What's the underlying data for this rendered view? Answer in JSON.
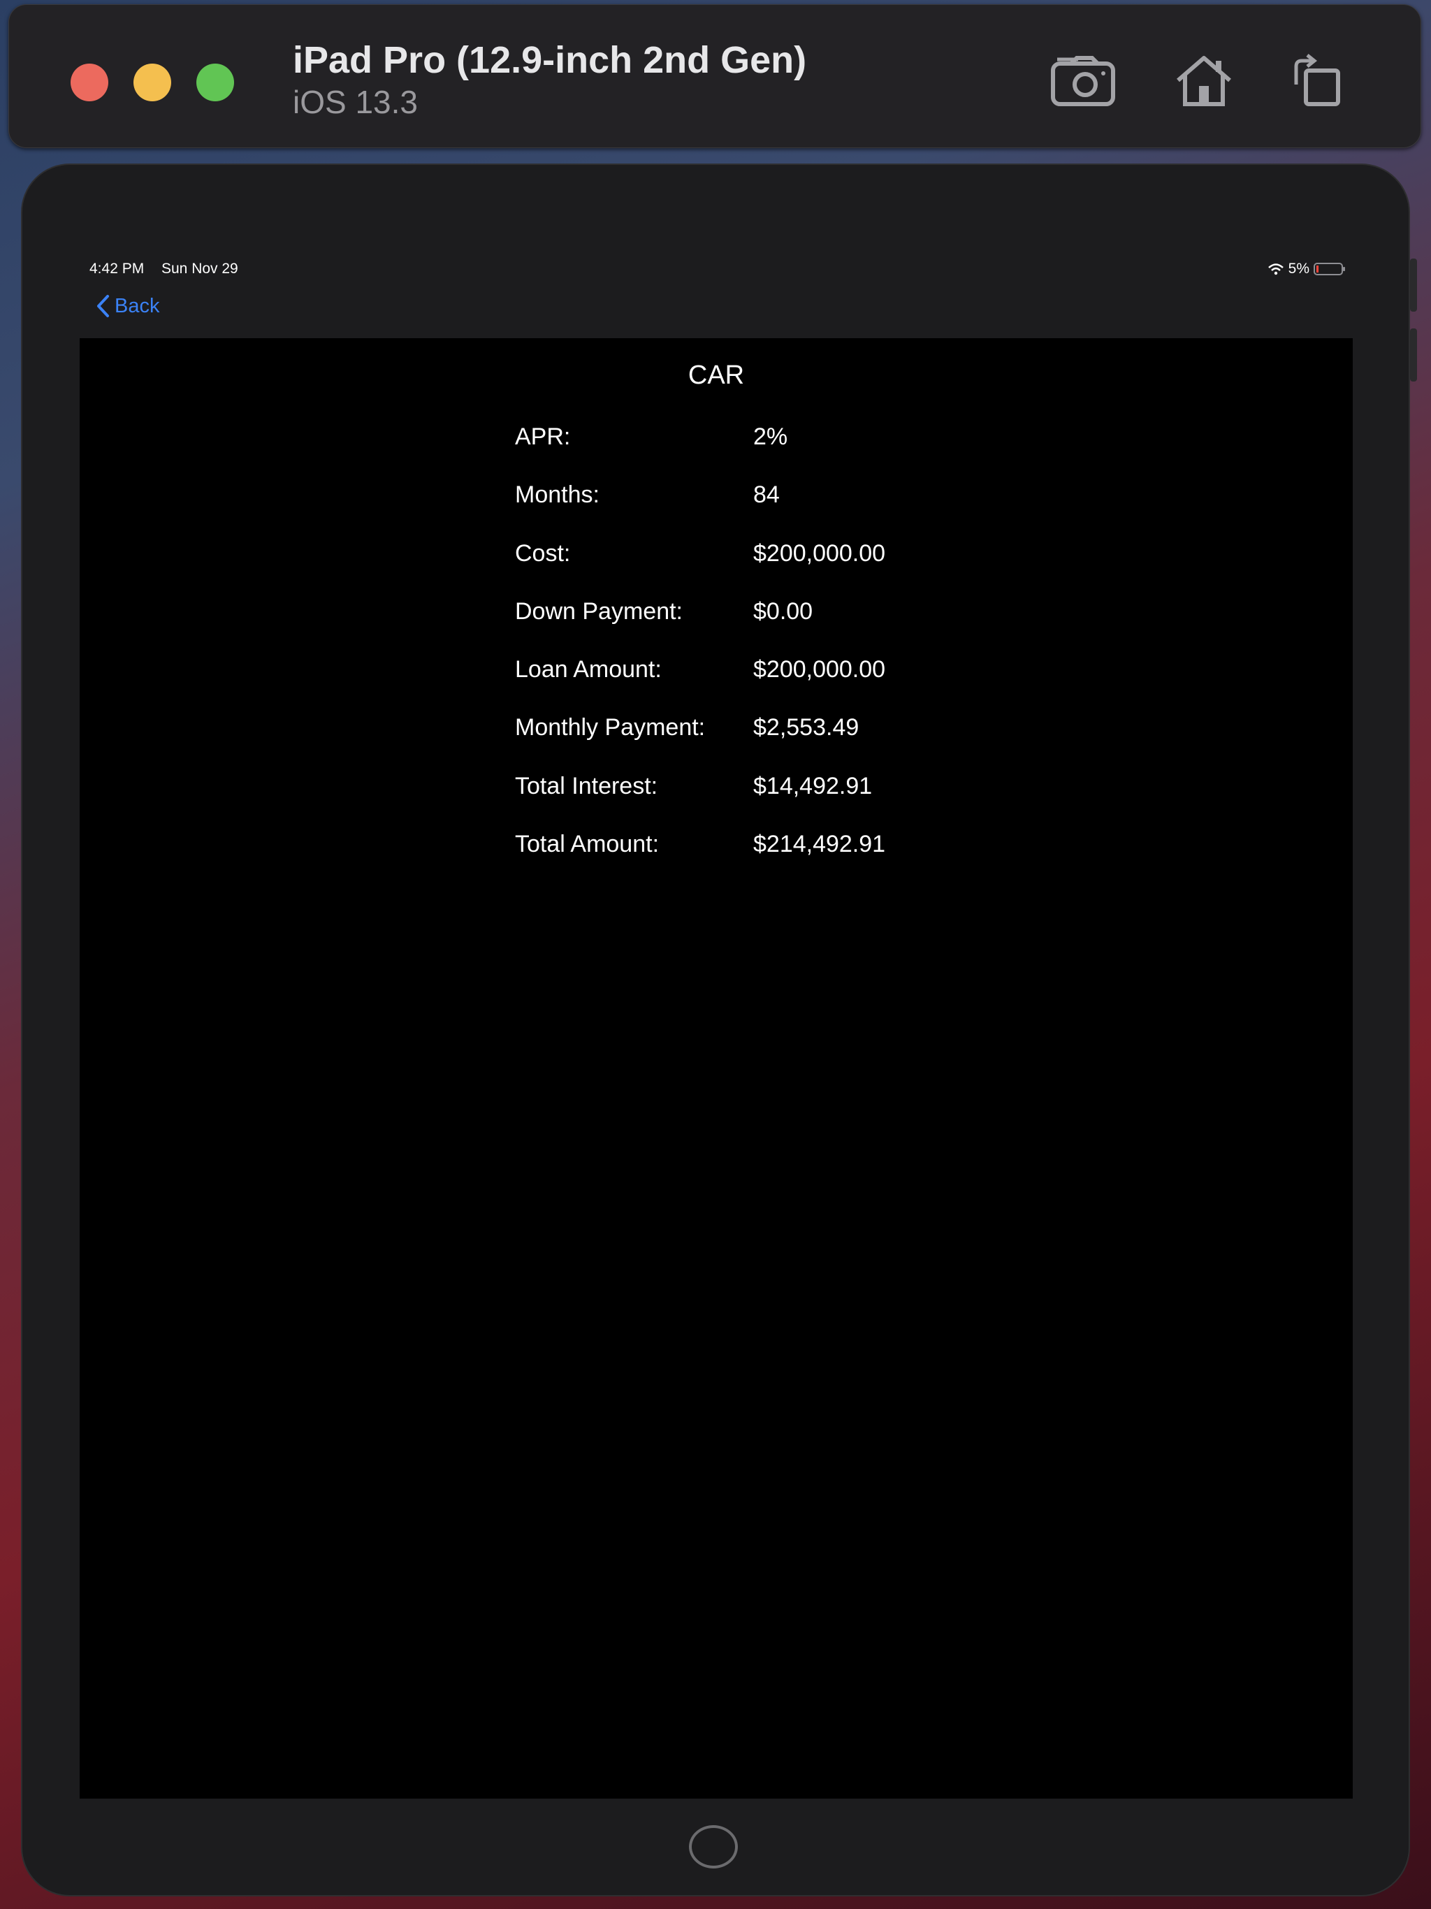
{
  "simulator": {
    "device_name": "iPad Pro (12.9-inch 2nd Gen)",
    "os_version": "iOS 13.3",
    "buttons": [
      "screenshot-icon",
      "home-icon",
      "rotate-icon"
    ]
  },
  "status_bar": {
    "time": "4:42 PM",
    "date": "Sun Nov 29",
    "battery": "5%"
  },
  "nav": {
    "back_label": "Back"
  },
  "content": {
    "title": "CAR",
    "rows": [
      {
        "label": "APR:",
        "value": "2%"
      },
      {
        "label": "Months:",
        "value": "84"
      },
      {
        "label": "Cost:",
        "value": "$200,000.00"
      },
      {
        "label": "Down Payment:",
        "value": "$0.00"
      },
      {
        "label": "Loan Amount:",
        "value": "$200,000.00"
      },
      {
        "label": "Monthly Payment:",
        "value": "$2,553.49"
      },
      {
        "label": "Total Interest:",
        "value": "$14,492.91"
      },
      {
        "label": "Total Amount:",
        "value": "$214,492.91"
      }
    ]
  },
  "colors": {
    "accent": "#3b82f6",
    "screen_background": "#000000",
    "bar_background": "#1c1c1e"
  }
}
